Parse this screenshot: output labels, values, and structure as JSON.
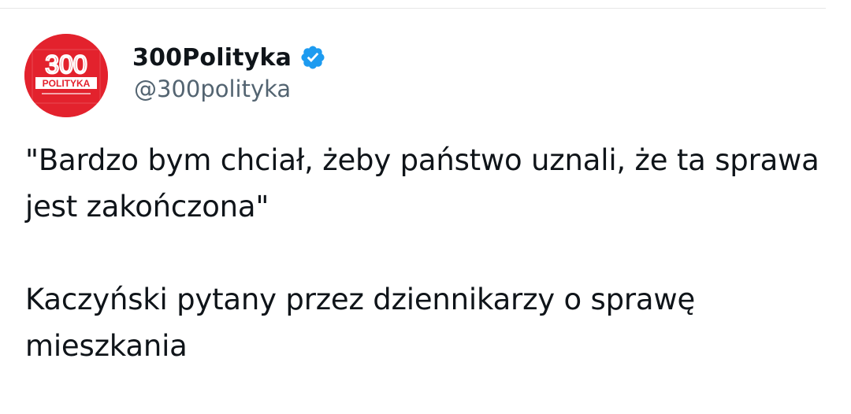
{
  "author": {
    "name": "300Polityka",
    "handle": "@300polityka",
    "verified": true,
    "avatar": {
      "logo_number": "300",
      "logo_word": "POLITYKA",
      "background_color": "#e3222d"
    }
  },
  "tweet": {
    "paragraphs": [
      "\"Bardzo bym chciał, żeby państwo uznali, że ta sprawa jest zakończona\"",
      "Kaczyński pytany przez dziennikarzy o sprawę mieszkania"
    ]
  },
  "colors": {
    "text": "#0f1419",
    "handle": "#536471",
    "verified_badge": "#1d9bf0",
    "divider": "#e6e6e6"
  },
  "icons": {
    "verified": "verified-badge-icon"
  }
}
